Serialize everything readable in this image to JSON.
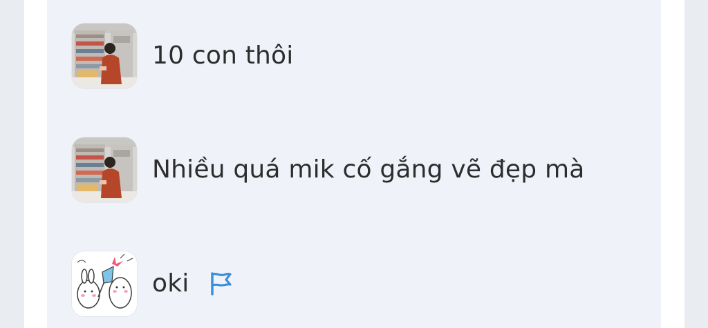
{
  "messages": [
    {
      "text": "10 con thôi",
      "avatar": "store-photo-avatar"
    },
    {
      "text": "Nhiều quá mik cố gắng vẽ đẹp mà",
      "avatar": "store-photo-avatar"
    },
    {
      "text": "oki",
      "avatar": "bunny-sticker-avatar",
      "action_icon": "flag-icon"
    }
  ],
  "colors": {
    "page_bg": "#e9ecf1",
    "frame_bg": "#ffffff",
    "chat_bg": "#eff3f9",
    "text": "#2d2d2d",
    "flag": "#3b8fd9"
  }
}
